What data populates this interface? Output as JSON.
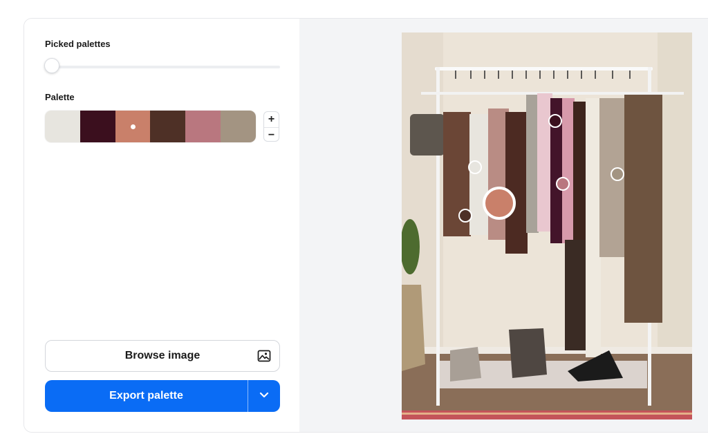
{
  "controls": {
    "picked_palettes_label": "Picked palettes",
    "picked_palettes_value": 0,
    "palette_label": "Palette",
    "palette": [
      {
        "color": "#e7e5df"
      },
      {
        "color": "#3b0f1e"
      },
      {
        "color": "#c9806a",
        "selected": true
      },
      {
        "color": "#4e3026"
      },
      {
        "color": "#b9777f"
      },
      {
        "color": "#a39482"
      }
    ],
    "stepper": {
      "plus": "+",
      "minus": "−"
    }
  },
  "actions": {
    "browse_label": "Browse image",
    "browse_icon": "image-icon",
    "export_label": "Export palette",
    "export_dropdown_icon": "chevron-down-icon"
  },
  "colors": {
    "accent": "#0a6cf5",
    "panel_bg": "#f3f4f6"
  }
}
